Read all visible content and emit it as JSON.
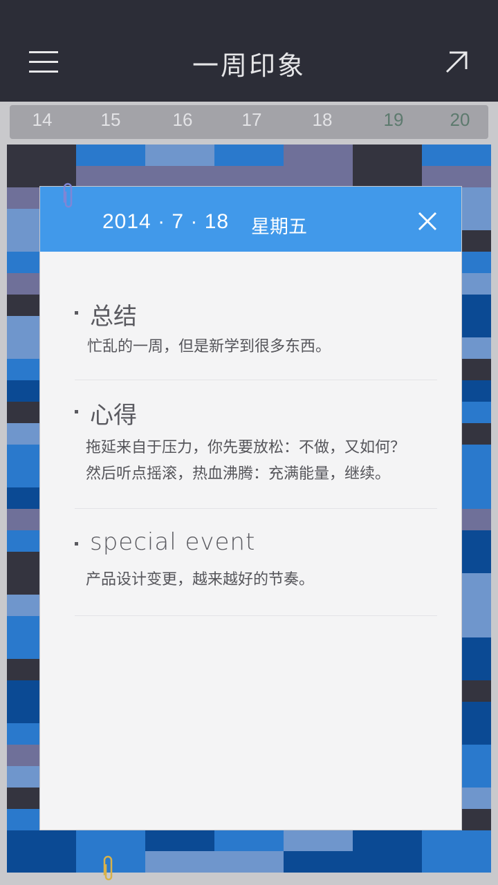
{
  "header": {
    "title": "一周印象",
    "menu_icon": "menu-icon",
    "share_icon": "arrow-up-right-icon"
  },
  "week_strip": {
    "days": [
      "14",
      "15",
      "16",
      "17",
      "18",
      "19",
      "20"
    ],
    "weekend_days": [
      "19",
      "20"
    ]
  },
  "detail_card": {
    "date": "2014 · 7 · 18",
    "weekday": "星期五",
    "close_icon": "close-icon",
    "sections": [
      {
        "title": "总结",
        "lines": [
          "忙乱的一周，但是新学到很多东西。"
        ]
      },
      {
        "title": "心得",
        "lines": [
          "拖延来自于压力，你先要放松：不做，又如何？",
          "然后听点摇滚，热血沸腾：充满能量，继续。"
        ]
      },
      {
        "title": "special event",
        "lines": [
          "产品设计变更，越来越好的节奏。"
        ]
      }
    ]
  },
  "colors": {
    "topbar": "#2c2d37",
    "accent_blue": "#4199ea",
    "card_bg": "#f4f4f5",
    "weekend_day": "#5d7a6e"
  }
}
